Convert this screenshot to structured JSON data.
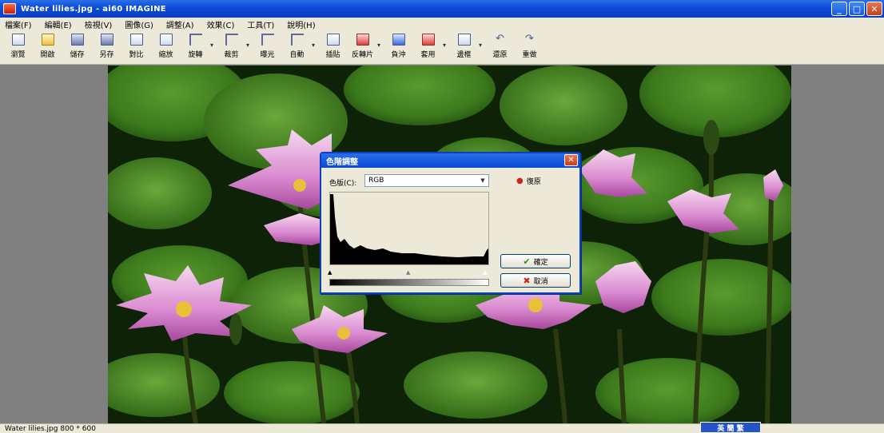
{
  "window": {
    "title": "Water lilies.jpg - ai60 IMAGINE",
    "controls": {
      "minimize": "_",
      "maximize": "□",
      "close": "✕"
    }
  },
  "menu": [
    "檔案(F)",
    "編輯(E)",
    "檢視(V)",
    "圖像(G)",
    "調整(A)",
    "效果(C)",
    "工具(T)",
    "說明(H)"
  ],
  "toolbar": {
    "items": [
      {
        "label": "瀏覽",
        "icon": "browse-icon"
      },
      {
        "label": "開啟",
        "icon": "open-folder-icon"
      },
      {
        "label": "儲存",
        "icon": "save-disk-icon"
      },
      {
        "label": "另存",
        "icon": "save-as-icon"
      },
      {
        "label": "對比",
        "icon": "compare-icon"
      },
      {
        "label": "縮放",
        "icon": "zoom-icon"
      },
      {
        "label": "旋轉",
        "icon": "rotate-icon"
      },
      {
        "label": "裁剪",
        "icon": "crop-icon"
      },
      {
        "label": "曝光",
        "icon": "exposure-icon"
      },
      {
        "label": "自動",
        "icon": "auto-icon"
      },
      {
        "label": "插貼",
        "icon": "paste-icon"
      },
      {
        "label": "反轉片",
        "icon": "invert-icon"
      },
      {
        "label": "負沖",
        "icon": "cross-process-icon"
      },
      {
        "label": "套用",
        "icon": "apply-icon"
      },
      {
        "label": "邊框",
        "icon": "frame-icon"
      },
      {
        "label": "還原",
        "icon": "undo-icon"
      },
      {
        "label": "重做",
        "icon": "redo-icon"
      }
    ]
  },
  "dialog": {
    "title": "色階調整",
    "close": "✕",
    "channel_label": "色版(C):",
    "channel_value": "RGB",
    "reset_label": "復原",
    "ok_label": "確定",
    "cancel_label": "取消"
  },
  "status": {
    "file_info": "Water lilies.jpg  800 * 600",
    "tray": "英 簡 繁"
  },
  "colors": {
    "titlebar": "#0a49d6",
    "chrome": "#ece9d8",
    "workspace": "#808080"
  }
}
